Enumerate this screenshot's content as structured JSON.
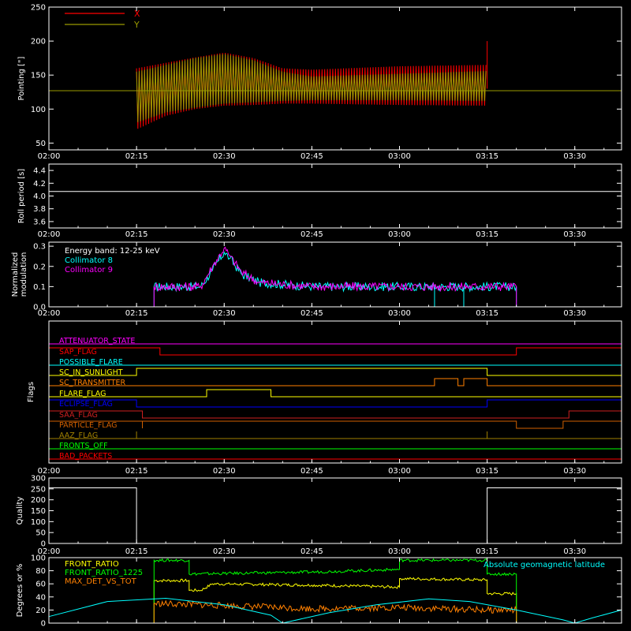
{
  "colors": {
    "background": "#000000",
    "axes": "#ffffff",
    "red": "#ff0000",
    "olive": "#9a9a00",
    "cyan": "#00ffff",
    "magenta": "#ff00ff",
    "yellow": "#ffff00",
    "green": "#00ff00",
    "orange": "#ff8000",
    "blue": "#0000ff",
    "crimson": "#cc2020",
    "orange_dark": "#d06000",
    "khaki": "#a08000",
    "white": "#ffffff"
  },
  "time_ticks": [
    "02:00",
    "02:15",
    "02:30",
    "02:45",
    "03:00",
    "03:15",
    "03:30"
  ],
  "chart_data": [
    {
      "id": "pointing",
      "type": "area",
      "ylabel": "Pointing [\"]",
      "ylim": [
        40,
        250
      ],
      "yticks": [
        50,
        100,
        150,
        200,
        250
      ],
      "legend": [
        {
          "name": "X",
          "color": "#ff0000"
        },
        {
          "name": "Y",
          "color": "#9a9a00"
        }
      ],
      "reference_level": 127,
      "series": [
        {
          "name": "X",
          "envelope": [
            {
              "t": "02:15",
              "lo": 70,
              "hi": 160
            },
            {
              "t": "02:20",
              "lo": 90,
              "hi": 168
            },
            {
              "t": "02:25",
              "lo": 100,
              "hi": 176
            },
            {
              "t": "02:30",
              "lo": 105,
              "hi": 183
            },
            {
              "t": "02:35",
              "lo": 106,
              "hi": 175
            },
            {
              "t": "02:40",
              "lo": 108,
              "hi": 160
            },
            {
              "t": "02:45",
              "lo": 108,
              "hi": 158
            },
            {
              "t": "03:00",
              "lo": 106,
              "hi": 163
            },
            {
              "t": "03:15",
              "lo": 105,
              "hi": 165
            }
          ]
        },
        {
          "name": "Y",
          "envelope": [
            {
              "t": "02:15",
              "lo": 80,
              "hi": 155
            },
            {
              "t": "02:20",
              "lo": 95,
              "hi": 165
            },
            {
              "t": "02:25",
              "lo": 102,
              "hi": 175
            },
            {
              "t": "02:30",
              "lo": 108,
              "hi": 181
            },
            {
              "t": "02:35",
              "lo": 110,
              "hi": 172
            },
            {
              "t": "02:40",
              "lo": 112,
              "hi": 155
            },
            {
              "t": "02:45",
              "lo": 113,
              "hi": 148
            },
            {
              "t": "03:00",
              "lo": 113,
              "hi": 152
            },
            {
              "t": "03:15",
              "lo": 112,
              "hi": 156
            }
          ]
        }
      ]
    },
    {
      "id": "roll",
      "type": "line",
      "ylabel": "Roll period [s]",
      "ylim": [
        3.5,
        4.5
      ],
      "yticks": [
        3.6,
        3.8,
        4.0,
        4.2,
        4.4
      ],
      "series": [
        {
          "name": "",
          "points": [
            [
              "02:00",
              4.07
            ],
            [
              "03:38",
              4.07
            ]
          ]
        }
      ]
    },
    {
      "id": "modulation",
      "type": "line",
      "ylabel": "Normalized modulation",
      "ylim": [
        0,
        0.32
      ],
      "yticks": [
        0.0,
        0.1,
        0.2,
        0.3
      ],
      "annotation": "Energy band: 12-25 keV",
      "legend": [
        {
          "name": "Collimator 8",
          "color": "#00ffff"
        },
        {
          "name": "Collimator 9",
          "color": "#ff00ff"
        }
      ],
      "series": [
        {
          "name": "Collimator 8",
          "points": [
            [
              "02:00",
              0.0
            ],
            [
              "02:18",
              0.0
            ],
            [
              "02:18",
              0.1
            ],
            [
              "02:26",
              0.1
            ],
            [
              "02:28",
              0.18
            ],
            [
              "02:30",
              0.27
            ],
            [
              "02:31",
              0.24
            ],
            [
              "02:33",
              0.16
            ],
            [
              "02:36",
              0.12
            ],
            [
              "02:45",
              0.1
            ],
            [
              "03:00",
              0.1
            ],
            [
              "03:18",
              0.1
            ],
            [
              "03:20",
              0.1
            ],
            [
              "03:20",
              0.0
            ],
            [
              "03:38",
              0.0
            ]
          ]
        },
        {
          "name": "Collimator 9",
          "points": [
            [
              "02:00",
              0.0
            ],
            [
              "02:18",
              0.0
            ],
            [
              "02:18",
              0.1
            ],
            [
              "02:26",
              0.1
            ],
            [
              "02:28",
              0.2
            ],
            [
              "02:30",
              0.29
            ],
            [
              "02:31",
              0.25
            ],
            [
              "02:33",
              0.17
            ],
            [
              "02:36",
              0.12
            ],
            [
              "02:45",
              0.1
            ],
            [
              "03:00",
              0.1
            ],
            [
              "03:18",
              0.1
            ],
            [
              "03:20",
              0.1
            ],
            [
              "03:20",
              0.0
            ],
            [
              "03:38",
              0.0
            ]
          ]
        }
      ]
    },
    {
      "id": "flags",
      "type": "line",
      "ylabel": "Flags",
      "rows": [
        {
          "name": "ATTENUATOR_STATE",
          "color": "#ff00ff",
          "segments": [
            [
              "02:00",
              0
            ],
            [
              "03:38",
              0
            ]
          ]
        },
        {
          "name": "SAP_FLAG",
          "color": "#ff0000",
          "segments": [
            [
              "02:00",
              1
            ],
            [
              "02:19",
              1
            ],
            [
              "02:19",
              0
            ],
            [
              "03:20",
              0
            ],
            [
              "03:20",
              1
            ],
            [
              "03:38",
              1
            ]
          ]
        },
        {
          "name": "POSSIBLE_FLARE",
          "color": "#00ffff",
          "segments": [
            [
              "02:00",
              0
            ],
            [
              "03:38",
              0
            ]
          ]
        },
        {
          "name": "SC_IN_SUNLIGHT",
          "color": "#ffff00",
          "segments": [
            [
              "02:00",
              0
            ],
            [
              "02:15",
              0
            ],
            [
              "02:15",
              1
            ],
            [
              "03:15",
              1
            ],
            [
              "03:15",
              0
            ],
            [
              "03:38",
              0
            ]
          ]
        },
        {
          "name": "SC_TRANSMITTER",
          "color": "#ff8000",
          "segments": [
            [
              "02:00",
              0
            ],
            [
              "03:06",
              0
            ],
            [
              "03:06",
              1
            ],
            [
              "03:10",
              1
            ],
            [
              "03:10",
              0
            ],
            [
              "03:11",
              0
            ],
            [
              "03:11",
              1
            ],
            [
              "03:15",
              1
            ],
            [
              "03:15",
              0
            ],
            [
              "03:38",
              0
            ]
          ]
        },
        {
          "name": "FLARE_FLAG",
          "color": "#ffff00",
          "segments": [
            [
              "02:00",
              0
            ],
            [
              "02:27",
              0
            ],
            [
              "02:27",
              1
            ],
            [
              "02:38",
              1
            ],
            [
              "02:38",
              0
            ],
            [
              "03:38",
              0
            ]
          ]
        },
        {
          "name": "ECLIPSE_FLAG",
          "color": "#0000ff",
          "segments": [
            [
              "02:00",
              1
            ],
            [
              "02:15",
              1
            ],
            [
              "02:15",
              0
            ],
            [
              "03:15",
              0
            ],
            [
              "03:15",
              1
            ],
            [
              "03:38",
              1
            ]
          ]
        },
        {
          "name": "SAA_FLAG",
          "color": "#cc2020",
          "segments": [
            [
              "02:00",
              1
            ],
            [
              "02:16",
              1
            ],
            [
              "02:16",
              0
            ],
            [
              "03:29",
              0
            ],
            [
              "03:29",
              1
            ],
            [
              "03:38",
              1
            ]
          ]
        },
        {
          "name": "PARTICLE_FLAG",
          "color": "#d06000",
          "segments": [
            [
              "02:00",
              1
            ],
            [
              "02:16",
              1
            ],
            [
              "02:16",
              0
            ],
            [
              "02:16",
              1
            ],
            [
              "03:20",
              1
            ],
            [
              "03:20",
              0
            ],
            [
              "03:28",
              0
            ],
            [
              "03:28",
              1
            ],
            [
              "03:38",
              1
            ]
          ]
        },
        {
          "name": "AAZ_FLAG",
          "color": "#a08000",
          "segments": [
            [
              "02:00",
              0
            ],
            [
              "02:15",
              0
            ],
            [
              "02:15",
              1
            ],
            [
              "02:15",
              0
            ],
            [
              "03:15",
              0
            ],
            [
              "03:15",
              1
            ],
            [
              "03:15",
              0
            ],
            [
              "03:38",
              0
            ]
          ]
        },
        {
          "name": "FRONTS_OFF",
          "color": "#00ff00",
          "segments": [
            [
              "02:00",
              0
            ],
            [
              "03:38",
              0
            ]
          ]
        },
        {
          "name": "BAD_PACKETS",
          "color": "#ff0000",
          "segments": [
            [
              "02:00",
              0
            ],
            [
              "03:38",
              0
            ]
          ]
        }
      ]
    },
    {
      "id": "quality",
      "type": "line",
      "ylabel": "Quality",
      "ylim": [
        0,
        300
      ],
      "yticks": [
        0,
        50,
        100,
        150,
        200,
        250,
        300
      ],
      "series": [
        {
          "name": "",
          "points": [
            [
              "02:00",
              255
            ],
            [
              "02:15",
              255
            ],
            [
              "02:15",
              0
            ],
            [
              "03:15",
              0
            ],
            [
              "03:15",
              255
            ],
            [
              "03:38",
              255
            ]
          ]
        }
      ]
    },
    {
      "id": "degrees",
      "type": "line",
      "ylabel": "Degrees or %",
      "ylim": [
        0,
        100
      ],
      "yticks": [
        0,
        20,
        40,
        60,
        80,
        100
      ],
      "legend": [
        {
          "name": "FRONT_RATIO",
          "color": "#ffff00"
        },
        {
          "name": "FRONT_RATIO_1225",
          "color": "#00ff00"
        },
        {
          "name": "MAX_DET_VS_TOT",
          "color": "#ff8000"
        }
      ],
      "right_legend": {
        "name": "Absolute geomagnetic latitude",
        "color": "#00ffff"
      },
      "series": [
        {
          "name": "FRONT_RATIO",
          "points": [
            [
              "02:18",
              0
            ],
            [
              "02:18",
              65
            ],
            [
              "02:24",
              65
            ],
            [
              "02:24",
              50
            ],
            [
              "02:26",
              50
            ],
            [
              "02:28",
              60
            ],
            [
              "02:45",
              58
            ],
            [
              "03:00",
              55
            ],
            [
              "03:00",
              68
            ],
            [
              "03:15",
              66
            ],
            [
              "03:15",
              45
            ],
            [
              "03:20",
              45
            ],
            [
              "03:20",
              0
            ]
          ]
        },
        {
          "name": "FRONT_RATIO_1225",
          "points": [
            [
              "02:18",
              0
            ],
            [
              "02:18",
              96
            ],
            [
              "02:24",
              96
            ],
            [
              "02:24",
              75
            ],
            [
              "02:45",
              78
            ],
            [
              "03:00",
              82
            ],
            [
              "03:00",
              96
            ],
            [
              "03:15",
              96
            ],
            [
              "03:15",
              75
            ],
            [
              "03:20",
              75
            ],
            [
              "03:20",
              0
            ]
          ]
        },
        {
          "name": "MAX_DET_VS_TOT",
          "points": [
            [
              "02:18",
              0
            ],
            [
              "02:18",
              30
            ],
            [
              "02:30",
              27
            ],
            [
              "02:45",
              22
            ],
            [
              "03:00",
              24
            ],
            [
              "03:15",
              20
            ],
            [
              "03:20",
              20
            ],
            [
              "03:20",
              0
            ]
          ]
        },
        {
          "name": "Absolute geomagnetic latitude",
          "points": [
            [
              "02:00",
              10
            ],
            [
              "02:10",
              33
            ],
            [
              "02:20",
              38
            ],
            [
              "02:30",
              28
            ],
            [
              "02:38",
              12
            ],
            [
              "02:40",
              0
            ],
            [
              "02:48",
              16
            ],
            [
              "02:56",
              28
            ],
            [
              "03:05",
              37
            ],
            [
              "03:12",
              33
            ],
            [
              "03:20",
              20
            ],
            [
              "03:28",
              5
            ],
            [
              "03:30",
              0
            ],
            [
              "03:33",
              8
            ],
            [
              "03:38",
              20
            ]
          ]
        }
      ]
    }
  ]
}
